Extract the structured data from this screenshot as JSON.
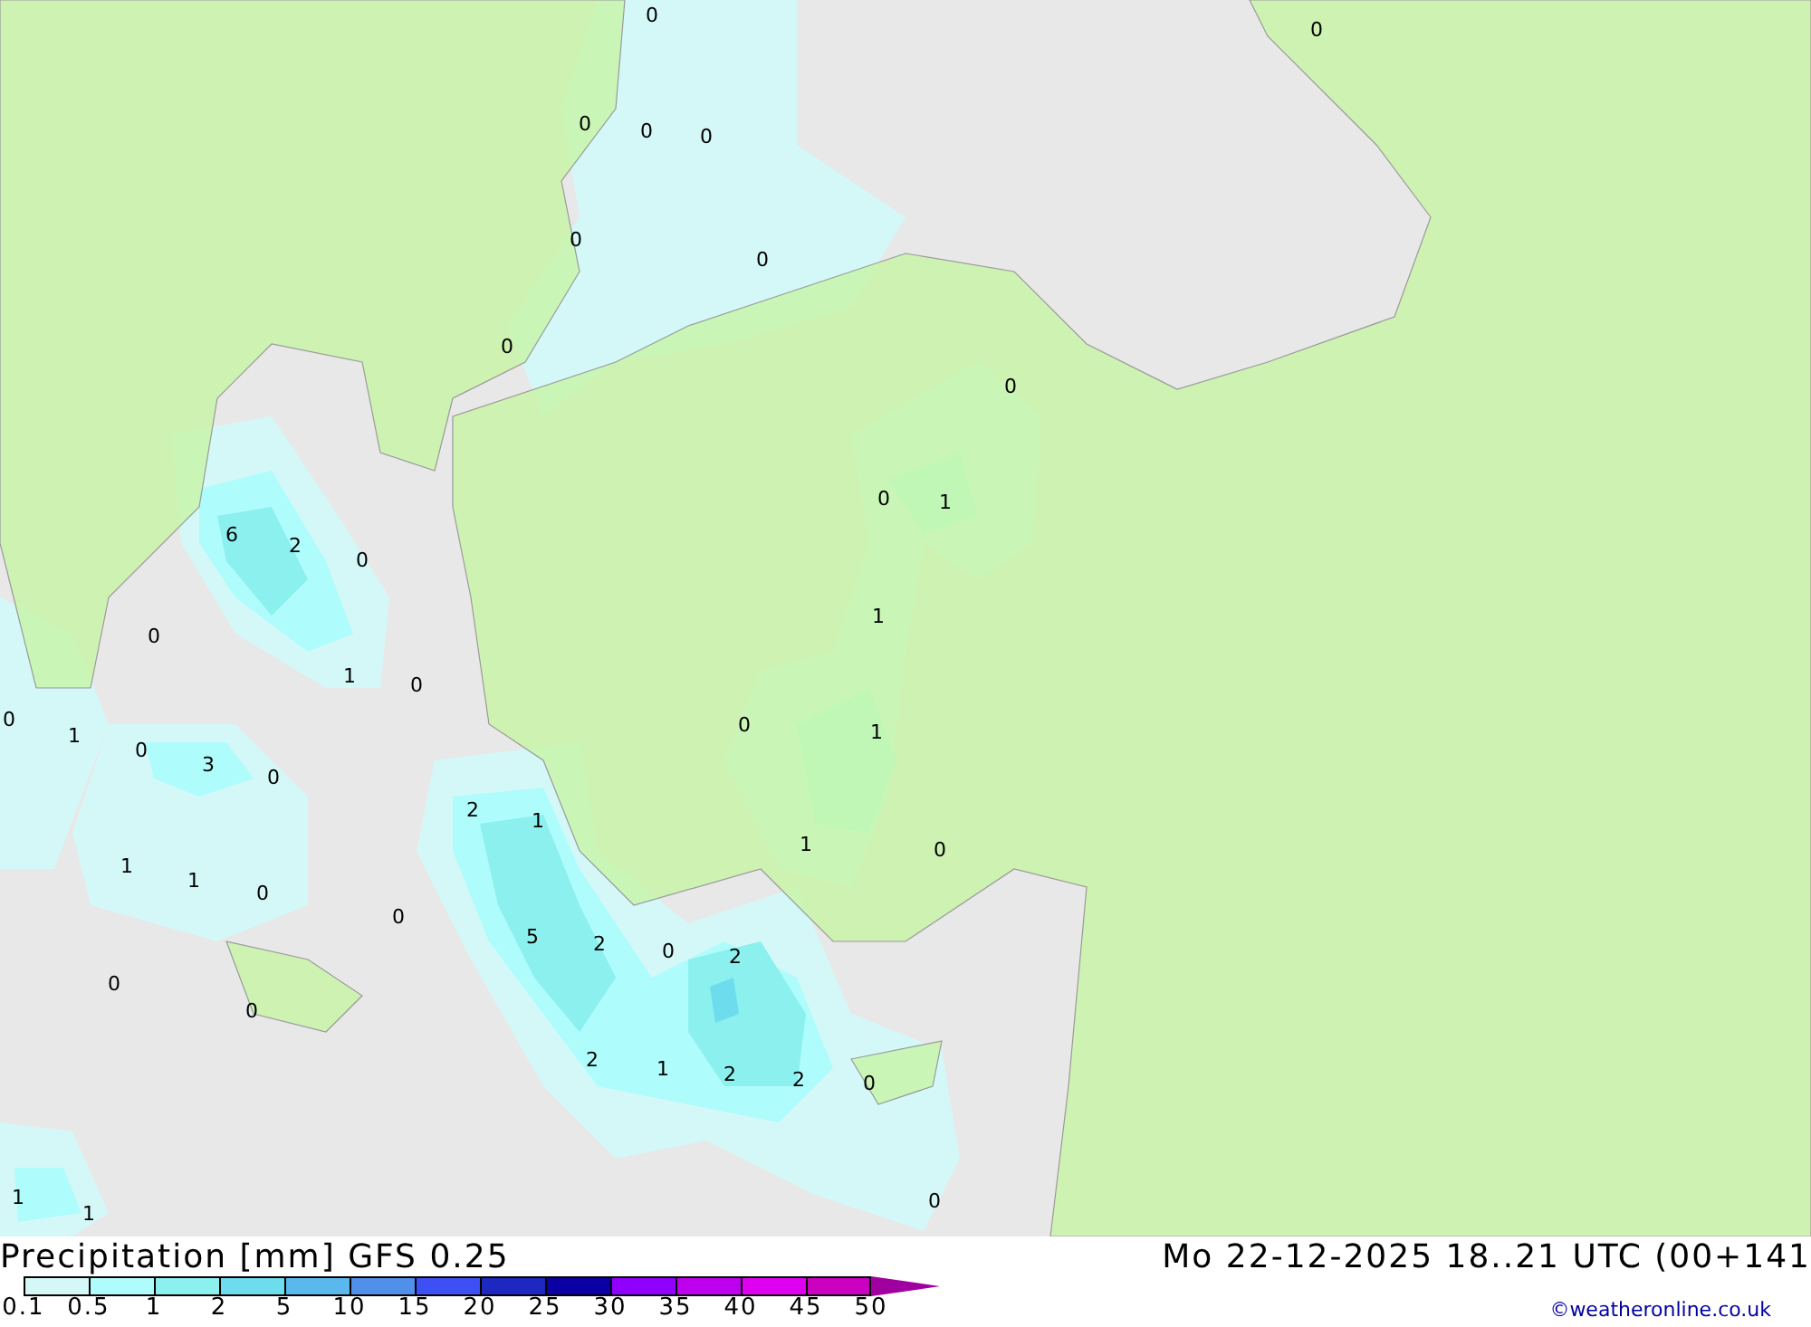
{
  "map": {
    "value_labels": [
      "0",
      "0",
      "0",
      "0",
      "0",
      "0",
      "0",
      "0",
      "0",
      "0",
      "1",
      "6",
      "2",
      "0",
      "1",
      "0",
      "1",
      "0",
      "0",
      "0",
      "1",
      "1",
      "0",
      "3",
      "0",
      "2",
      "1",
      "1",
      "0",
      "1",
      "1",
      "0",
      "0",
      "5",
      "2",
      "0",
      "2",
      "0",
      "0",
      "2",
      "1",
      "2",
      "2",
      "0",
      "1",
      "1",
      "0"
    ]
  },
  "footer": {
    "title": "Precipitation [mm] GFS 0.25",
    "valid_time": "Mo 22-12-2025 18..21 UTC (00+141",
    "credit": "©weatheronline.co.uk",
    "legend": {
      "swatches": [
        {
          "color": "#d4f8f8"
        },
        {
          "color": "#aefcfc"
        },
        {
          "color": "#8cf0ee"
        },
        {
          "color": "#6ddcec"
        },
        {
          "color": "#5ab8ec"
        },
        {
          "color": "#5090ea"
        },
        {
          "color": "#3c50f4"
        },
        {
          "color": "#1c28c0"
        },
        {
          "color": "#0a00a4"
        },
        {
          "color": "#9000ff"
        },
        {
          "color": "#bf00ee"
        },
        {
          "color": "#e000f0"
        },
        {
          "color": "#cc00c0"
        }
      ],
      "ticks": [
        "0.1",
        "0.5",
        "1",
        "2",
        "5",
        "10",
        "15",
        "20",
        "25",
        "30",
        "35",
        "40",
        "45",
        "50"
      ]
    }
  }
}
